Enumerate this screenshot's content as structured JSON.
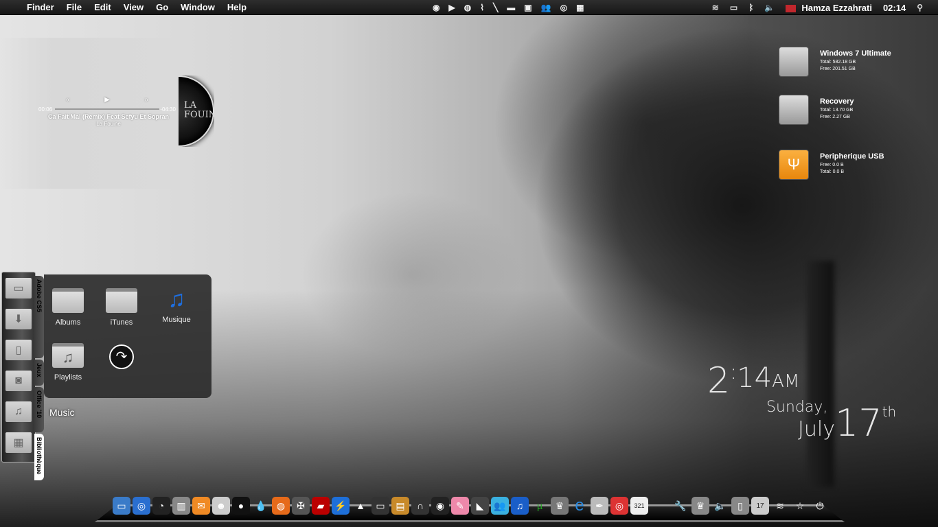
{
  "menubar": {
    "apple": "",
    "items": [
      "Finder",
      "File",
      "Edit",
      "View",
      "Go",
      "Window",
      "Help"
    ],
    "status_icons": [
      "compass-icon",
      "play-icon",
      "firefox-icon",
      "pulse-icon",
      "feather-icon",
      "clapper-icon",
      "display-icon",
      "users-icon",
      "chrome-icon",
      "grid-icon"
    ],
    "right_icons": [
      "wifi-icon",
      "battery-icon",
      "bluetooth-icon",
      "volume-icon"
    ],
    "user": "Hamza Ezzahrati",
    "time": "02:14",
    "flag_color": "#c1272d"
  },
  "player": {
    "elapsed": "00:06",
    "remaining": "-04:30",
    "song": "Ca Fait Mal (Remix) Feat Sefyu Et Sopran",
    "artist": "La Fouine",
    "album_art_text": "LA FOUINE",
    "prev": "«",
    "play": "▶",
    "next": "»"
  },
  "drives": [
    {
      "name": "Windows 7 Ultimate",
      "line1": "Total: 582.18 GB",
      "line2": "Free: 201.51 GB",
      "icon": "hard-drive-icon"
    },
    {
      "name": "Recovery",
      "line1": "Total: 13.70 GB",
      "line2": "Free: 2.27 GB",
      "icon": "hard-drive-icon"
    },
    {
      "name": "Peripherique USB",
      "line1": "Free: 0.0 B",
      "line2": "Total: 0.0 B",
      "icon": "usb-drive-icon"
    }
  ],
  "clock": {
    "hour": "2",
    "colon": ":",
    "minutes": "14",
    "ampm": "AM",
    "weekday": "Sunday,",
    "month": "July",
    "day": "17",
    "suffix": "th"
  },
  "stacks": {
    "tabs": [
      "Adobe CS5",
      "Jeux",
      "Office '10",
      "Bibliothèque"
    ],
    "active_tab": "Bibliothèque",
    "items": [
      {
        "label": "Albums"
      },
      {
        "label": "iTunes"
      },
      {
        "label": "Musique"
      },
      {
        "label": "Playlists"
      }
    ],
    "tooltip": "Music"
  },
  "dock": {
    "left": [
      "imac",
      "safari",
      "dashboard",
      "trash",
      "mail",
      "finder",
      "dvd-player",
      "water-drop",
      "firefox",
      "batman",
      "car",
      "daemon-tools",
      "vlc",
      "desktop",
      "winrar",
      "headphones",
      "camera",
      "paint",
      "nfs",
      "messenger",
      "itunes",
      "utorrent",
      "fifa",
      "internet-explorer",
      "feather",
      "chrome",
      "media-player"
    ],
    "right": [
      "wrench",
      "real-madrid",
      "volume",
      "battery",
      "calendar",
      "wifi",
      "star",
      "power"
    ],
    "calendar_day": "17",
    "media_label": "321"
  }
}
